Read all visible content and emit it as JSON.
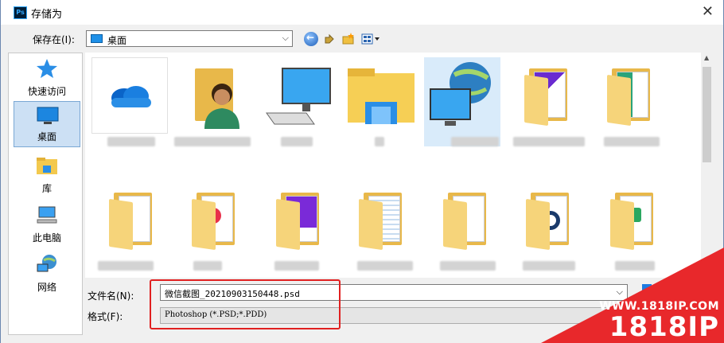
{
  "window": {
    "title": "存储为",
    "app_badge": "Ps"
  },
  "toolbar": {
    "save_in_label": "保存在(I):",
    "location_value": "桌面"
  },
  "sidebar": {
    "items": [
      {
        "label": "快速访问",
        "icon": "star-icon"
      },
      {
        "label": "桌面",
        "icon": "desktop-icon",
        "selected": true
      },
      {
        "label": "库",
        "icon": "library-folder-icon"
      },
      {
        "label": "此电脑",
        "icon": "computer-icon"
      },
      {
        "label": "网络",
        "icon": "network-globe-icon"
      }
    ]
  },
  "files": {
    "row1": [
      "onedrive-icon",
      "user-folder-icon",
      "computer-icon",
      "libraries-folder-icon",
      "network-icon",
      "folder-purple-icon",
      "folder-green-icon"
    ],
    "row2": [
      "folder-icon",
      "folder-red-icon",
      "folder-purple-icon",
      "folder-blue-icon",
      "folder-person-icon",
      "folder-chart-icon",
      "folder-excel-icon"
    ]
  },
  "form": {
    "filename_label": "文件名(N):",
    "filename_value": "微信截图_20210903150448.psd",
    "format_label": "格式(F):",
    "format_value": "Photoshop (*.PSD;*.PDD)"
  },
  "watermark": {
    "url": "WWW.1818IP.COM",
    "brand": "1818IP"
  }
}
